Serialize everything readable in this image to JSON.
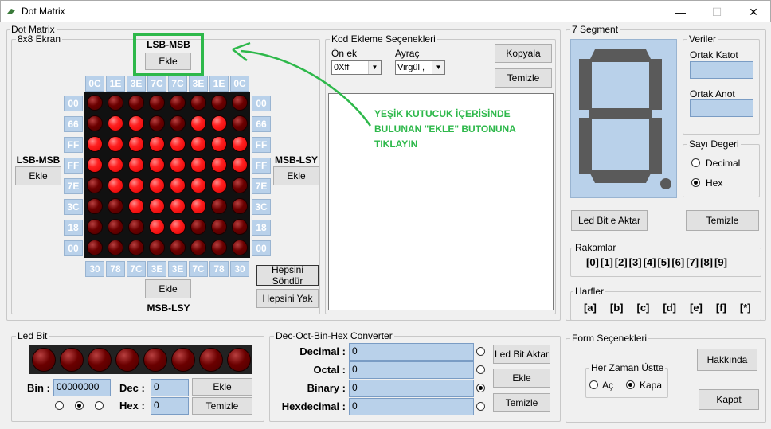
{
  "window": {
    "title": "Dot Matrix",
    "minimize": "—",
    "maximize": "☐",
    "close": "✕"
  },
  "dot_matrix": {
    "group_label": "Dot Matrix",
    "sub_label": "8x8 Ekran",
    "top_col_hex": [
      "0C",
      "1E",
      "3E",
      "7C",
      "7C",
      "3E",
      "1E",
      "0C"
    ],
    "bottom_col_hex": [
      "30",
      "78",
      "7C",
      "3E",
      "3E",
      "7C",
      "78",
      "30"
    ],
    "left_row_hex": [
      "00",
      "66",
      "FF",
      "FF",
      "7E",
      "3C",
      "18",
      "00"
    ],
    "right_row_hex": [
      "00",
      "66",
      "FF",
      "FF",
      "7E",
      "3C",
      "18",
      "00"
    ],
    "rows": [
      [
        0,
        0,
        0,
        0,
        0,
        0,
        0,
        0
      ],
      [
        0,
        1,
        1,
        0,
        0,
        1,
        1,
        0
      ],
      [
        1,
        1,
        1,
        1,
        1,
        1,
        1,
        1
      ],
      [
        1,
        1,
        1,
        1,
        1,
        1,
        1,
        1
      ],
      [
        0,
        1,
        1,
        1,
        1,
        1,
        1,
        0
      ],
      [
        0,
        0,
        1,
        1,
        1,
        1,
        0,
        0
      ],
      [
        0,
        0,
        0,
        1,
        1,
        0,
        0,
        0
      ],
      [
        0,
        0,
        0,
        0,
        0,
        0,
        0,
        0
      ]
    ],
    "top_title": "LSB-MSB",
    "top_button": "Ekle",
    "left_title": "LSB-MSB",
    "left_button": "Ekle",
    "right_title": "MSB-LSY",
    "right_button": "Ekle",
    "bottom_title": "MSB-LSY",
    "bottom_button": "Ekle",
    "hepsini_sondur": "Hepsini Söndür",
    "hepsini_yak": "Hepsini Yak"
  },
  "kod_ekleme": {
    "group_label": "Kod Ekleme Seçenekleri",
    "on_ek_label": "Ön ek",
    "on_ek_value": "0Xff",
    "ayrac_label": "Ayraç",
    "ayrac_value": "Virgül ,",
    "kopyala": "Kopyala",
    "temizle": "Temizle",
    "annotation": "YEŞİK KUTUCUK İÇERİSİNDE BULUNAN \"EKLE\" BUTONUNA TIKLAYIN"
  },
  "seven_segment": {
    "group_label": "7 Segment",
    "veriler_label": "Veriler",
    "ortak_katot": "Ortak Katot",
    "ortak_anot": "Ortak Anot",
    "sayi_label": "Sayı Degeri",
    "decimal": "Decimal",
    "hex": "Hex",
    "led_bit_aktar": "Led Bit e Aktar",
    "temizle": "Temizle",
    "rakamlar_label": "Rakamlar",
    "rakamlar": [
      "[0]",
      "[1]",
      "[2]",
      "[3]",
      "[4]",
      "[5]",
      "[6]",
      "[7]",
      "[8]",
      "[9]"
    ],
    "harfler_label": "Harfler",
    "harfler": [
      "[a]",
      "[b]",
      "[c]",
      "[d]",
      "[e]",
      "[f]",
      "[*]"
    ]
  },
  "led_bit": {
    "group_label": "Led Bit",
    "bin_label": "Bin :",
    "bin_value": "00000000",
    "dec_label": "Dec :",
    "dec_value": "0",
    "hex_label": "Hex :",
    "hex_value": "0",
    "ekle": "Ekle",
    "temizle": "Temizle"
  },
  "converter": {
    "group_label": "Dec-Oct-Bin-Hex Converter",
    "decimal_label": "Decimal :",
    "decimal_value": "0",
    "octal_label": "Octal :",
    "octal_value": "0",
    "binary_label": "Binary :",
    "binary_value": "0",
    "hex_label": "Hexdecimal :",
    "hex_value": "0",
    "led_bit_aktar": "Led Bit Aktar",
    "ekle": "Ekle",
    "temizle": "Temizle"
  },
  "form": {
    "group_label": "Form Seçenekleri",
    "her_zaman_label": "Her Zaman Üstte",
    "ac": "Aç",
    "kapa": "Kapa",
    "hakkinda": "Hakkında",
    "kapat": "Kapat"
  }
}
